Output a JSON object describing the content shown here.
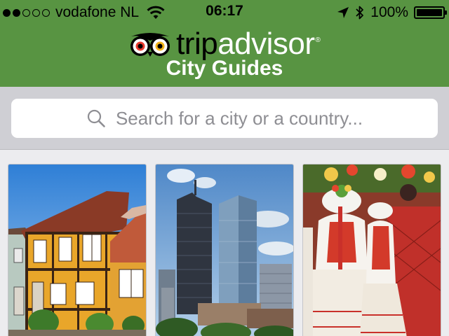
{
  "status_bar": {
    "carrier": "vodafone NL",
    "time": "06:17",
    "battery": "100%",
    "battery_level": 1.0,
    "signal_bars_filled": 2,
    "signal_bars_total": 5
  },
  "header": {
    "brand_trip": "trip",
    "brand_advisor": "advisor",
    "brand_reg": "®",
    "subtitle": "City Guides"
  },
  "search": {
    "placeholder": "Search for a city or a country..."
  },
  "colors": {
    "header_green": "#589442",
    "search_bg": "#cfcfd4",
    "grid_bg": "#ececef"
  },
  "icons": {
    "search": "search-icon",
    "wifi": "wifi-icon",
    "location": "location-arrow-icon",
    "bluetooth": "bluetooth-icon",
    "battery": "battery-icon",
    "owl": "owl-logo-icon"
  }
}
